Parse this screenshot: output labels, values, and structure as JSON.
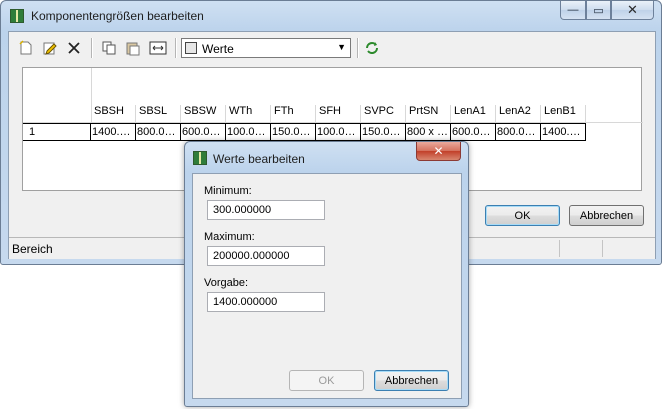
{
  "main_window": {
    "title": "Komponentengrößen bearbeiten",
    "controls": {
      "minimize": "—",
      "maximize": "▭",
      "close": "✕"
    },
    "toolbar": {
      "icons": [
        "new-page-icon",
        "edit-pencil-icon",
        "delete-x-icon",
        "copy-icon",
        "paste-icon",
        "resize-field-icon",
        "refresh-icon"
      ],
      "combo_value": "Werte",
      "combo_arrow": "▼"
    },
    "grid": {
      "columns": [
        "SBSH",
        "SBSL",
        "SBSW",
        "WTh",
        "FTh",
        "SFH",
        "SVPC",
        "PrtSN",
        "LenA1",
        "LenA2",
        "LenB1"
      ],
      "rows": [
        {
          "number": "1",
          "cells": [
            "1400.…",
            "800.0…",
            "600.0…",
            "100.0…",
            "150.0…",
            "100.0…",
            "150.0…",
            "800 x …",
            "600.0…",
            "800.0…",
            "1400.…"
          ]
        }
      ]
    },
    "ok_label": "OK",
    "cancel_label": "Abbrechen",
    "status_text": "Bereich"
  },
  "dialog": {
    "title": "Werte bearbeiten",
    "close_glyph": "✕",
    "minimum_label": "Minimum:",
    "minimum_value": "300.000000",
    "maximum_label": "Maximum:",
    "maximum_value": "200000.000000",
    "default_label": "Vorgabe:",
    "default_value": "1400.000000",
    "ok_label": "OK",
    "cancel_label": "Abbrechen"
  }
}
